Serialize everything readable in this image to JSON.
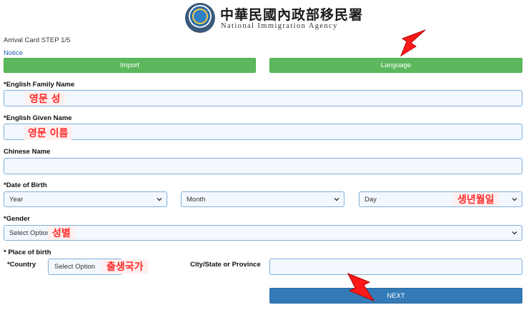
{
  "header": {
    "agency_cn": "中華民國內政部移民署",
    "agency_en": "National Immigration Agency"
  },
  "form": {
    "step": "Arrival Card STEP 1/5",
    "notice": "Notice",
    "import_label": "Import",
    "language_label": "Language",
    "family_name": {
      "label": "*English Family Name",
      "annotation": "영문 성",
      "value": ""
    },
    "given_name": {
      "label": "*English Given Name",
      "annotation": "영문 이름",
      "value": ""
    },
    "chinese_name": {
      "label": "Chinese Name",
      "value": ""
    },
    "dob": {
      "label": "*Date of Birth",
      "year": "Year",
      "month": "Month",
      "day": "Day",
      "annotation": "생년월일"
    },
    "gender": {
      "label": "*Gender",
      "selected": "Select Option",
      "annotation": "성별"
    },
    "place_of_birth": {
      "label": "* Place of birth",
      "country_label": "*Country",
      "country_selected": "Select Option",
      "country_annotation": "출생국가",
      "city_label": "City/State or Province",
      "city_value": ""
    },
    "next_label": "NEXT"
  },
  "colors": {
    "green_button": "#5cb85c",
    "blue_button": "#337ab7",
    "input_border": "#7fb0da",
    "input_bg": "#f3f8fe",
    "annotation_red": "#ff2a2a",
    "link_blue": "#1f5fb0"
  },
  "icons": [
    "agency-seal-icon",
    "chevron-down-icon",
    "red-arrow-icon"
  ]
}
